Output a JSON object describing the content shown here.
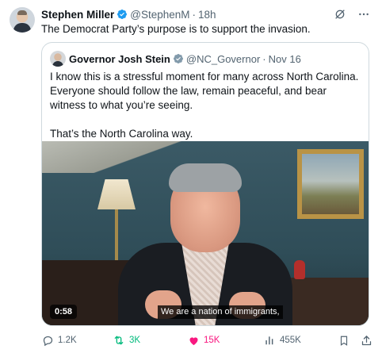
{
  "tweet": {
    "author_name": "Stephen Miller",
    "author_handle": "@StephenM",
    "separator": "·",
    "time": "18h",
    "text": "The Democrat Party’s purpose is to support the invasion."
  },
  "quote": {
    "author_name": "Governor Josh Stein",
    "author_handle": "@NC_Governor",
    "separator": "·",
    "date": "Nov 16",
    "paragraph1": "I know this is a stressful moment for many across North Carolina. Everyone should follow the law, remain peaceful, and bear witness to what you’re seeing.",
    "paragraph2": "That’s the North Carolina way.",
    "video": {
      "duration": "0:58",
      "caption": "We are a nation of immigrants,"
    }
  },
  "actions": {
    "reply_count": "1.2K",
    "retweet_count": "3K",
    "like_count": "15K",
    "view_count": "455K"
  },
  "colors": {
    "verified_badge": "#1d9bf0",
    "retweet_active": "#00ba7c",
    "like_active": "#f91880",
    "muted_text": "#536471",
    "border": "#cfd9de"
  },
  "icons": {
    "verified": "verified-badge-icon",
    "grok": "grok-icon",
    "more": "more-icon",
    "reply": "reply-icon",
    "retweet": "retweet-icon",
    "like": "heart-icon",
    "views": "views-icon",
    "bookmark": "bookmark-icon",
    "share": "share-icon"
  }
}
